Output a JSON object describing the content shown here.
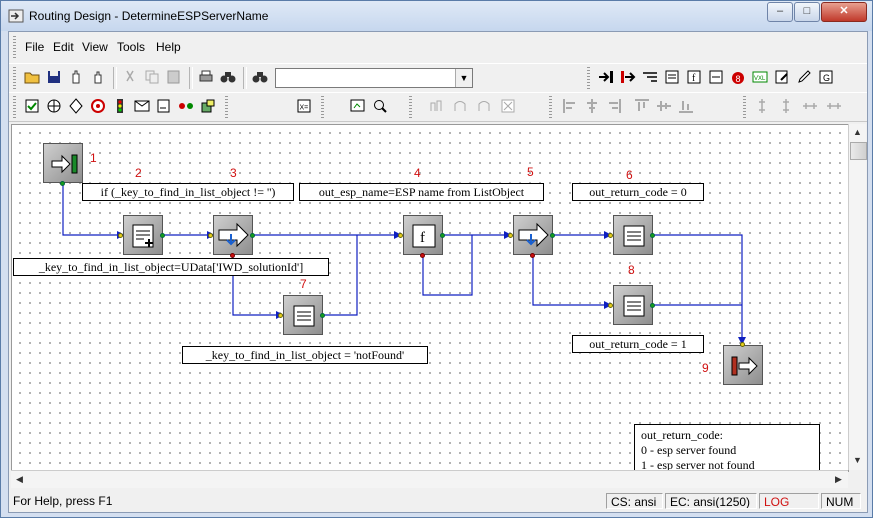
{
  "window": {
    "title": "Routing Design - DetermineESPServerName"
  },
  "menu": [
    "File",
    "Edit",
    "View",
    "Tools",
    "Help"
  ],
  "search": {
    "value": ""
  },
  "status": {
    "help": "For Help, press F1",
    "cs": "CS: ansi",
    "ec": "EC: ansi(1250)",
    "log": "LOG",
    "num": "NUM"
  },
  "colors": {
    "log": "#d01010",
    "connector": "#1020c0",
    "step_number": "#d01010"
  },
  "diagram": {
    "numbers": [
      "1",
      "2",
      "3",
      "4",
      "5",
      "6",
      "7",
      "8",
      "9"
    ],
    "labels": {
      "cond": "if (_key_to_find_in_list_object != '')",
      "assign_key": "_key_to_find_in_list_object=UData['IWD_solutionId']",
      "not_found": "_key_to_find_in_list_object = 'notFound'",
      "esp_name": "out_esp_name=ESP name from ListObject",
      "rc0": "out_return_code = 0",
      "rc1": "out_return_code = 1"
    },
    "note": [
      "out_return_code:",
      "0 - esp server found",
      "1 - esp server not found"
    ]
  }
}
